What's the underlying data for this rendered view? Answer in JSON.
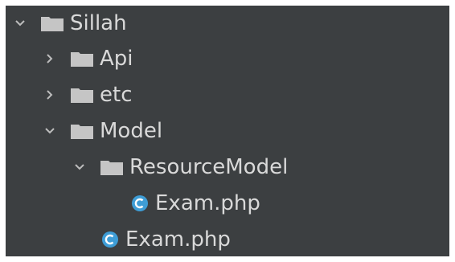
{
  "tree": {
    "items": [
      {
        "label": "Sillah",
        "kind": "folder",
        "expanded": true,
        "icon": "folder-icon"
      },
      {
        "label": "Api",
        "kind": "folder",
        "expanded": false,
        "icon": "folder-icon"
      },
      {
        "label": "etc",
        "kind": "folder",
        "expanded": false,
        "icon": "folder-icon"
      },
      {
        "label": "Model",
        "kind": "folder",
        "expanded": true,
        "icon": "folder-icon"
      },
      {
        "label": "ResourceModel",
        "kind": "folder",
        "expanded": true,
        "icon": "folder-icon"
      },
      {
        "label": "Exam.php",
        "kind": "file",
        "icon": "php-class-icon"
      },
      {
        "label": "Exam.php",
        "kind": "file",
        "icon": "php-class-icon"
      }
    ]
  },
  "colors": {
    "background": "#3c3f41",
    "text": "#d9d9d9",
    "folder": "#c5c5c5",
    "php_icon": "#3e9dd6"
  }
}
